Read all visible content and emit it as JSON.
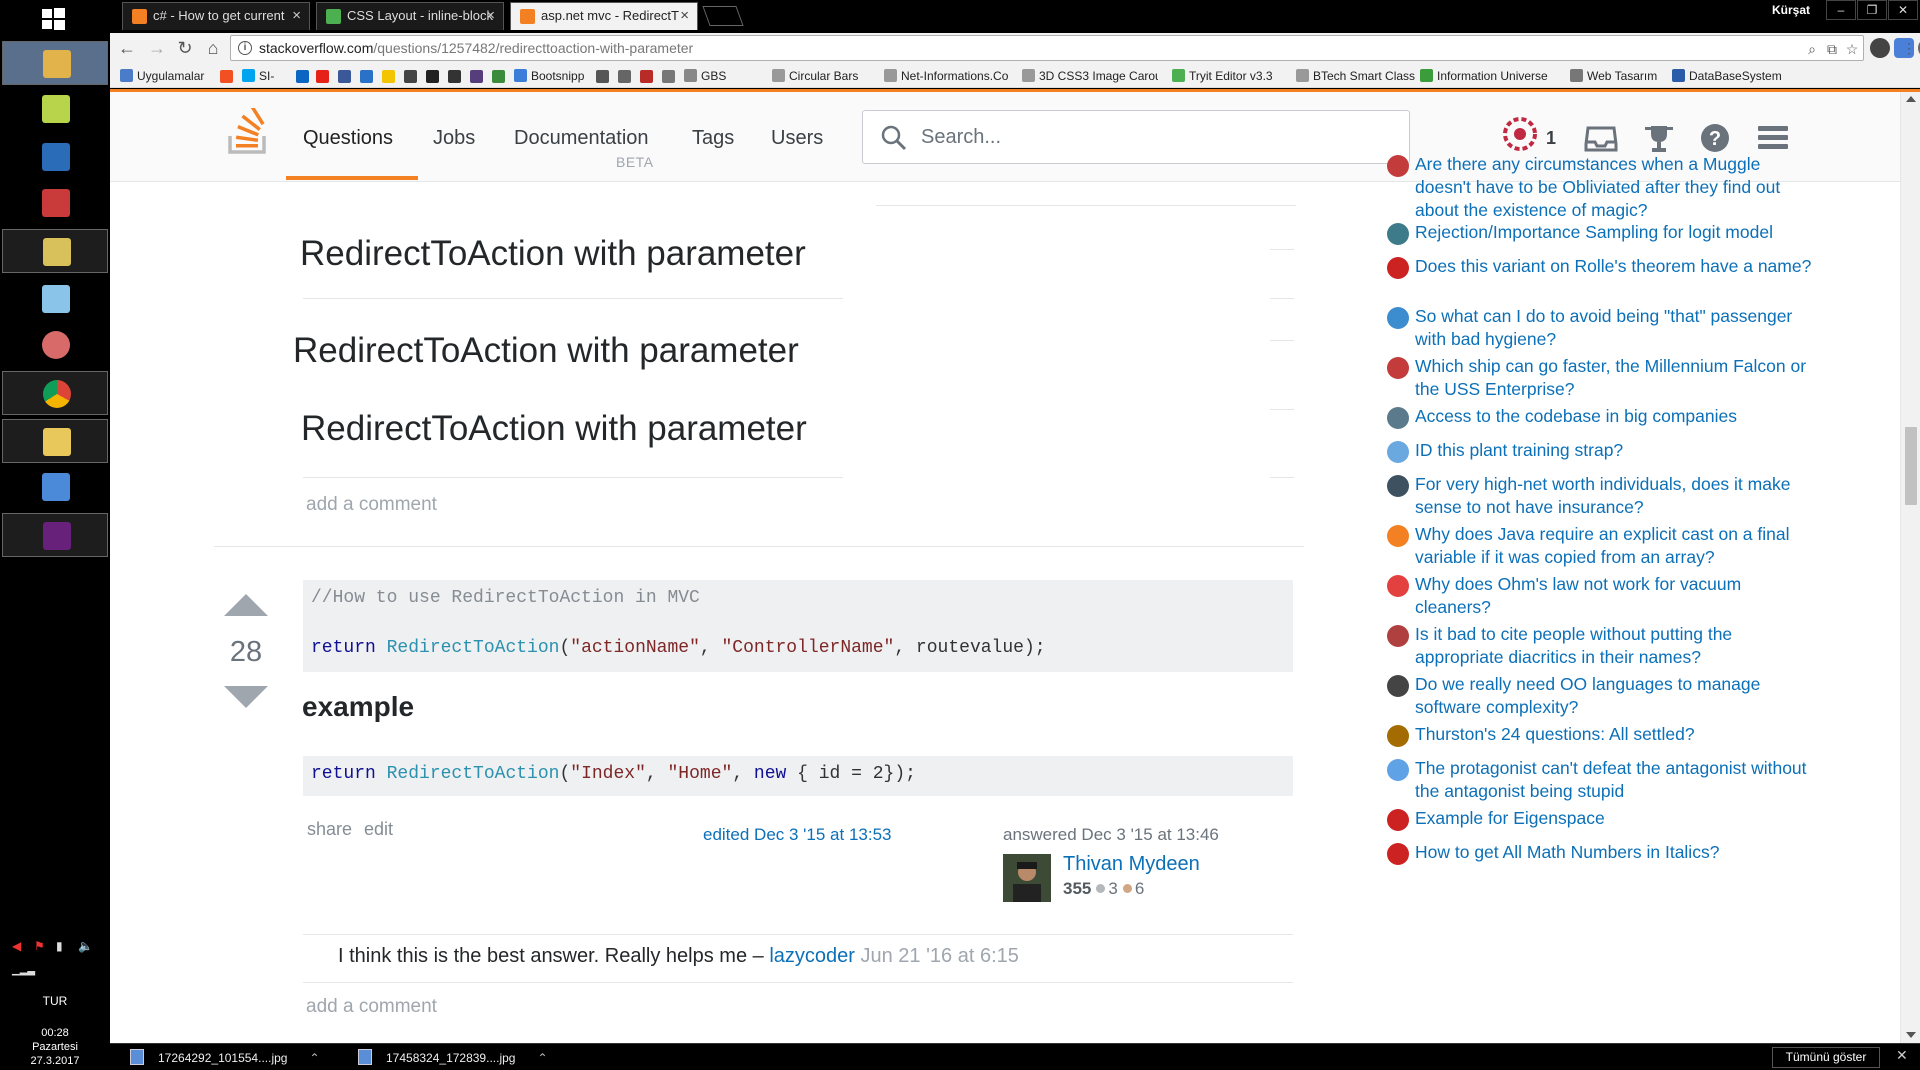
{
  "browser": {
    "tabs": [
      {
        "title": "c# - How to get current"
      },
      {
        "title": "CSS Layout - inline-block"
      },
      {
        "title": "asp.net mvc - RedirectT"
      }
    ],
    "user": "Kürşat",
    "url_host": "stackoverflow.com",
    "url_path": "/questions/1257482/redirecttoaction-with-parameter",
    "bookmarks": [
      "Uygulamalar",
      "SI-",
      "Bootsnipp",
      "GBS",
      "Circular Bars",
      "Net-Informations.Co",
      "3D CSS3 Image Carou",
      "Tryit Editor v3.3",
      "BTech Smart Class",
      "Information Universe",
      "Web Tasarım",
      "DataBaseSystem"
    ]
  },
  "taskbar": {
    "lang": "TUR",
    "time": "00:28",
    "day": "Pazartesi",
    "date": "27.3.2017"
  },
  "downloads": {
    "items": [
      "17264292_101554....jpg",
      "17458324_172839....jpg"
    ],
    "show_all": "Tümünü göster"
  },
  "so_header": {
    "nav": [
      "Questions",
      "Jobs",
      "Documentation",
      "Tags",
      "Users"
    ],
    "beta": "BETA",
    "search_placeholder": "Search...",
    "rep": "1"
  },
  "main": {
    "titles": [
      "RedirectToAction with parameter",
      "RedirectToAction with parameter",
      "RedirectToAction with parameter"
    ],
    "add_comment": "add a comment",
    "answer": {
      "votes": "28",
      "code1_comment": "//How to use RedirectToAction in MVC",
      "code1_kw": "return",
      "code1_fn": "RedirectToAction",
      "code1_args_open": "(",
      "code1_str1": "\"actionName\"",
      "code1_sep": ", ",
      "code1_str2": "\"ControllerName\"",
      "code1_tail": ", routevalue);",
      "heading": "example",
      "code2_kw": "return",
      "code2_fn": "RedirectToAction",
      "code2_open": "(",
      "code2_str1": "\"Index\"",
      "code2_sep": ", ",
      "code2_str2": "\"Home\"",
      "code2_mid": ", ",
      "code2_new": "new",
      "code2_tail": " { id = 2});",
      "share": "share",
      "edit": "edit",
      "edited": "edited Dec 3 '15 at 13:53",
      "answered": "answered Dec 3 '15 at 13:46",
      "user": "Thivan Mydeen",
      "user_rep": "355",
      "silver": "3",
      "bronze": "6",
      "comment_text": "I think this is the best answer. Really helps me – ",
      "comment_user": "lazycoder",
      "comment_date": " Jun 21 '16 at 6:15"
    }
  },
  "hot_network_questions": [
    {
      "text": "Are there any circumstances when a Muggle doesn't have to be Obliviated after they find out about the existence of magic?",
      "icon": "scifi-icon",
      "color": "#c33b3b"
    },
    {
      "text": "Rejection/Importance Sampling for logit model",
      "icon": "stats-icon",
      "color": "#3d7a8a"
    },
    {
      "text": "Does this variant on Rolle's theorem have a name?",
      "icon": "math-icon",
      "color": "#cc2222"
    },
    {
      "text": "So what can I do to avoid being \"that\" passenger with bad hygiene?",
      "icon": "travel-icon",
      "color": "#3c8cd0"
    },
    {
      "text": "Which ship can go faster, the Millennium Falcon or the USS Enterprise?",
      "icon": "scifi-icon",
      "color": "#c33b3b"
    },
    {
      "text": "Access to the codebase in big companies",
      "icon": "workplace-icon",
      "color": "#5b7a8c"
    },
    {
      "text": "ID this plant training strap?",
      "icon": "gardening-icon",
      "color": "#6aa8e0"
    },
    {
      "text": "For very high-net worth individuals, does it make sense to not have insurance?",
      "icon": "money-icon",
      "color": "#3e5160"
    },
    {
      "text": "Why does Java require an explicit cast on a final variable if it was copied from an array?",
      "icon": "stackoverflow-icon",
      "color": "#f48024"
    },
    {
      "text": "Why does Ohm's law not work for vacuum cleaners?",
      "icon": "physics-icon",
      "color": "#e34040"
    },
    {
      "text": "Is it bad to cite people without putting the appropriate diacritics in their names?",
      "icon": "academia-icon",
      "color": "#b04040"
    },
    {
      "text": "Do we really need OO languages to manage software complexity?",
      "icon": "softwareeng-icon",
      "color": "#444444"
    },
    {
      "text": "Thurston's 24 questions: All settled?",
      "icon": "mathoverflow-icon",
      "color": "#a36b00"
    },
    {
      "text": "The protagonist can't defeat the antagonist without the antagonist being stupid",
      "icon": "writing-icon",
      "color": "#5fa3e6"
    },
    {
      "text": "Example for Eigenspace",
      "icon": "math-icon",
      "color": "#cc2222"
    },
    {
      "text": "How to get All Math Numbers in Italics?",
      "icon": "tex-icon",
      "color": "#cc2222"
    }
  ]
}
